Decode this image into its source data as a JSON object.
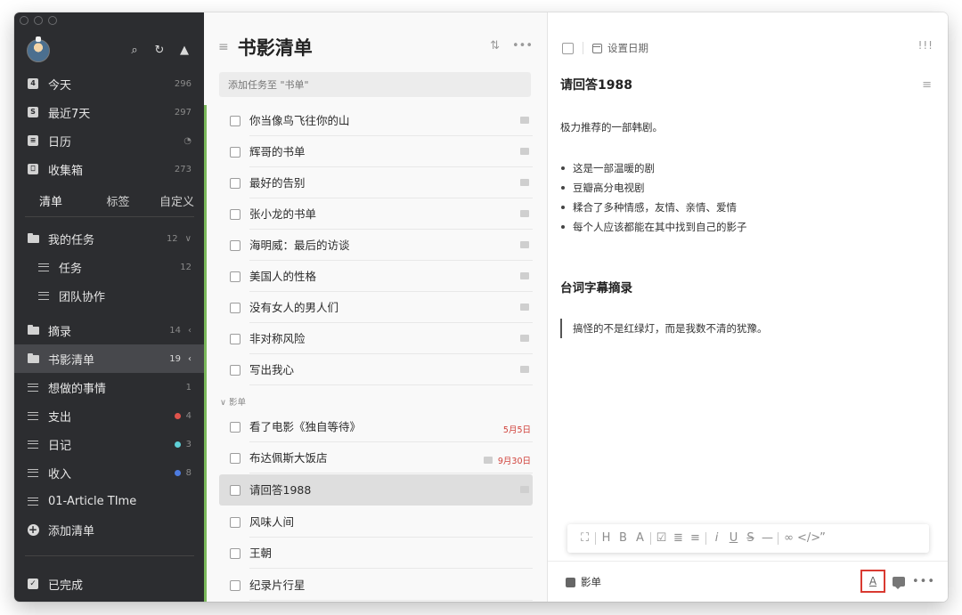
{
  "sidebar": {
    "smart_lists": [
      {
        "label": "今天",
        "count": "296",
        "icon": "calendar-day-icon"
      },
      {
        "label": "最近7天",
        "count": "297",
        "icon": "calendar-week-icon"
      },
      {
        "label": "日历",
        "count": "",
        "icon": "calendar-icon"
      },
      {
        "label": "收集箱",
        "count": "273",
        "icon": "inbox-icon"
      }
    ],
    "tabs": [
      "清单",
      "标签",
      "自定义"
    ],
    "lists": [
      {
        "label": "我的任务",
        "count": "12",
        "chevron": "∨",
        "icon": "folder-icon"
      },
      {
        "label": "任务",
        "count": "12",
        "chevron": "",
        "icon": "list-icon"
      },
      {
        "label": "团队协作",
        "count": "",
        "chevron": "",
        "icon": "list-icon"
      },
      {
        "label": "摘录",
        "count": "14",
        "chevron": "‹",
        "icon": "folder-icon"
      },
      {
        "label": "书影清单",
        "count": "19",
        "chevron": "‹",
        "icon": "folder-icon"
      },
      {
        "label": "想做的事情",
        "count": "1",
        "chevron": "",
        "icon": "list-icon"
      },
      {
        "label": "支出",
        "count": "4",
        "chevron": "",
        "icon": "list-icon",
        "dot": "#e0534c"
      },
      {
        "label": "日记",
        "count": "3",
        "chevron": "",
        "icon": "list-icon",
        "dot": "#5ecfd6"
      },
      {
        "label": "收入",
        "count": "8",
        "chevron": "",
        "icon": "list-icon",
        "dot": "#4d7be0"
      },
      {
        "label": "01-Article TIme",
        "count": "",
        "chevron": "",
        "icon": "list-icon"
      },
      {
        "label": "添加清单",
        "count": "",
        "chevron": "",
        "icon": "plus-circle-icon"
      }
    ],
    "completed_label": "已完成"
  },
  "middle": {
    "title": "书影清单",
    "add_placeholder": "添加任务至 \"书单\"",
    "section_label": "影单",
    "tasks": [
      {
        "label": "你当像鸟飞往你的山",
        "date": ""
      },
      {
        "label": "辉哥的书单",
        "date": ""
      },
      {
        "label": "最好的告别",
        "date": ""
      },
      {
        "label": "张小龙的书单",
        "date": ""
      },
      {
        "label": "海明威：最后的访谈",
        "date": ""
      },
      {
        "label": "美国人的性格",
        "date": ""
      },
      {
        "label": "没有女人的男人们",
        "date": ""
      },
      {
        "label": "非对称风险",
        "date": ""
      },
      {
        "label": "写出我心",
        "date": ""
      }
    ],
    "movie_tasks": [
      {
        "label": "看了电影《独自等待》",
        "date": "5月5日"
      },
      {
        "label": "布达佩斯大饭店",
        "date": "9月30日"
      },
      {
        "label": "请回答1988",
        "date": ""
      },
      {
        "label": "风味人间",
        "date": ""
      },
      {
        "label": "王朝",
        "date": ""
      },
      {
        "label": "纪录片行星",
        "date": ""
      }
    ]
  },
  "detail": {
    "set_date_label": "设置日期",
    "priority_label": "!!!",
    "title": "请回答1988",
    "paragraph": "极力推荐的一部韩剧。",
    "bullets": [
      "这是一部温暖的剧",
      "豆瓣高分电视剧",
      "糅合了多种情感，友情、亲情、爱情",
      "每个人应该都能在其中找到自己的影子"
    ],
    "heading": "台词字幕摘录",
    "quote": "搞怪的不是红绿灯，而是我数不清的犹豫。",
    "list_name": "影单",
    "toolbar_icons": [
      "expand-icon",
      "heading-icon",
      "bold-icon",
      "highlight-icon",
      "checkbox-icon",
      "bullet-list-icon",
      "numbered-list-icon",
      "italic-icon",
      "underline-icon",
      "strikethrough-icon",
      "horizontal-rule-icon",
      "link-icon",
      "code-icon",
      "quote-icon"
    ]
  },
  "colors": {
    "sidebar_bg": "#2c2d30",
    "accent_green": "#7ab85a",
    "date_red": "#d0413a",
    "highlight_border": "#d93a31"
  }
}
